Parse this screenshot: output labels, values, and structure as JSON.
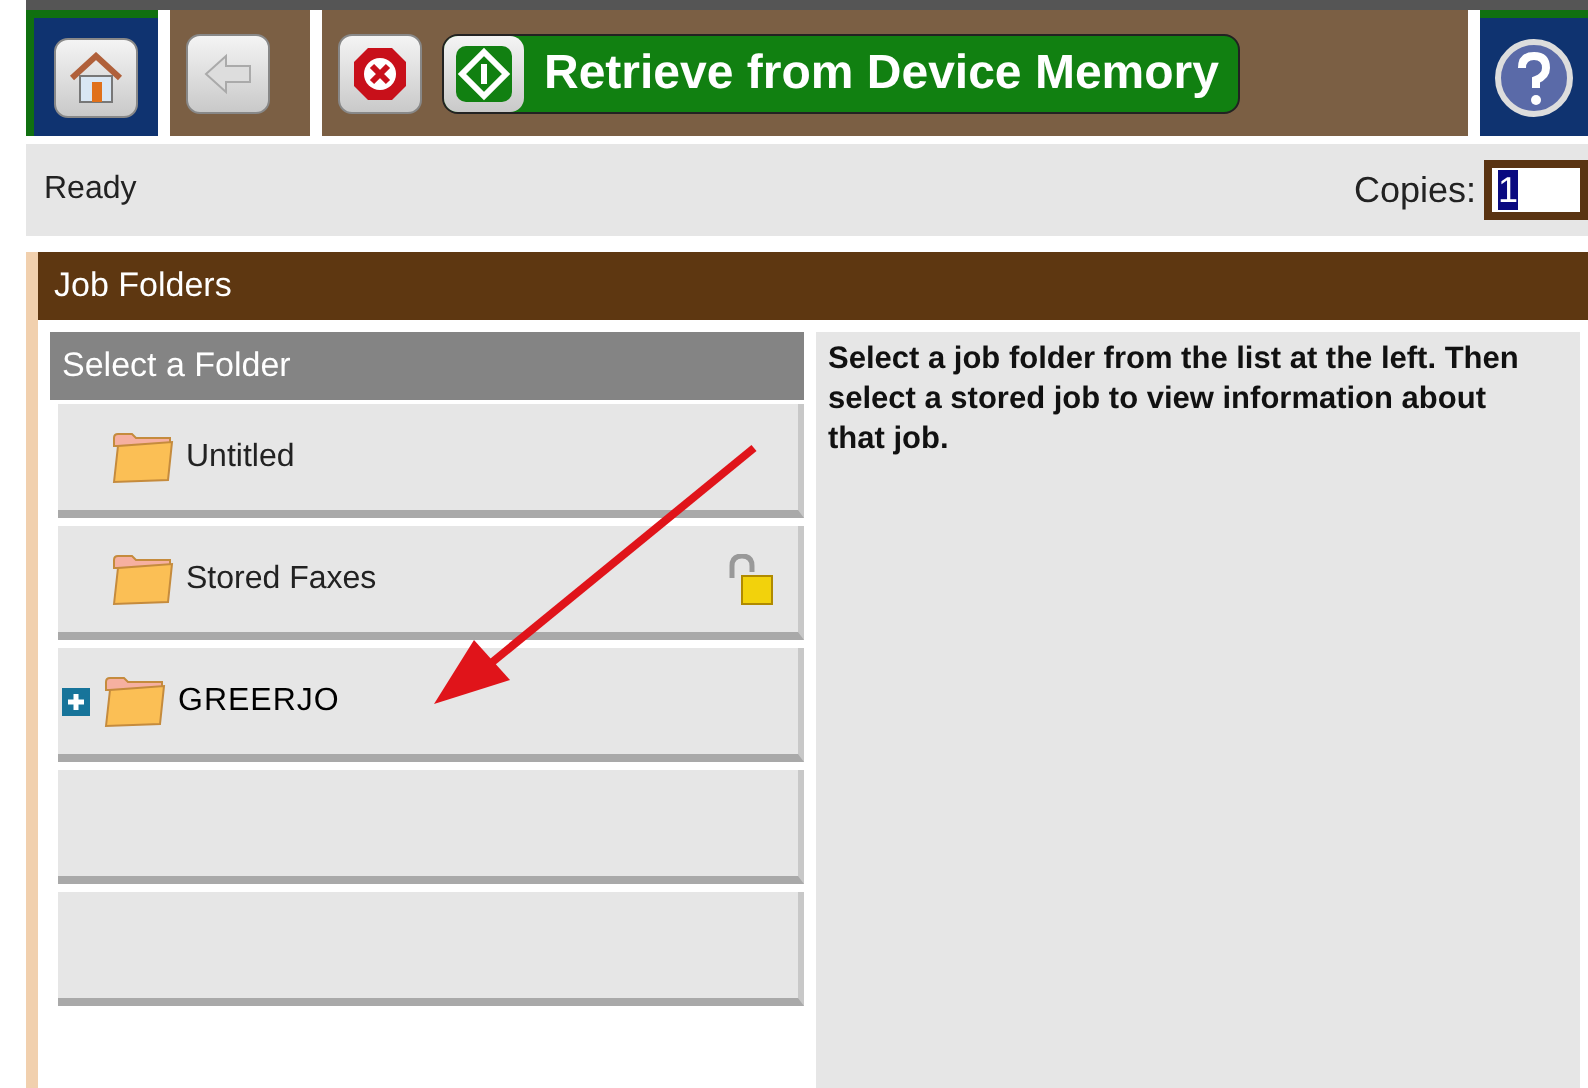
{
  "toolbar": {
    "title": "Retrieve from Device Memory"
  },
  "status": {
    "text": "Ready",
    "copies_label": "Copies:",
    "copies_value": "1"
  },
  "panel": {
    "title": "Job Folders",
    "list_title": "Select a Folder",
    "folders": [
      {
        "kind": "folder",
        "label": "Untitled",
        "locked": false,
        "expandable": false
      },
      {
        "kind": "folder",
        "label": "Stored Faxes",
        "locked": true,
        "expandable": false
      },
      {
        "kind": "folder",
        "label": "GREERJO",
        "locked": false,
        "expandable": true
      },
      {
        "kind": "empty"
      },
      {
        "kind": "empty"
      }
    ],
    "info": "Select a job folder from the list at the left. Then select a stored job to view information about that job."
  }
}
